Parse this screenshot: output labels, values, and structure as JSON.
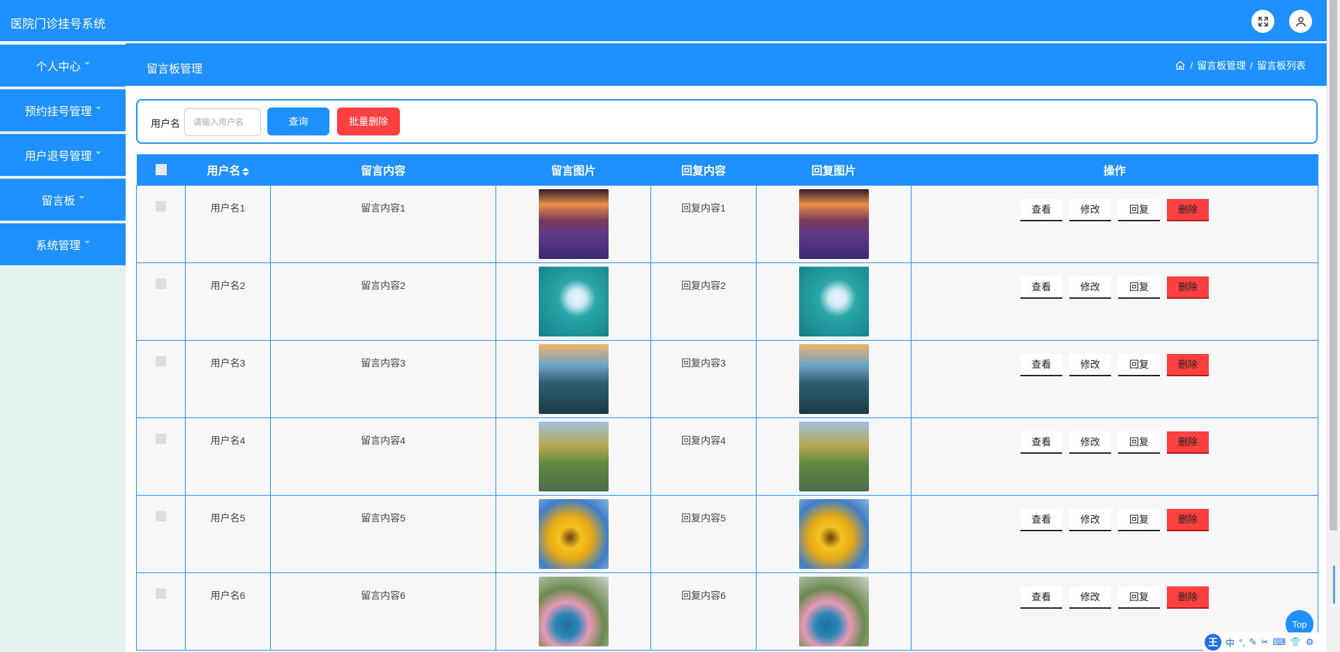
{
  "app": {
    "title": "医院门诊挂号系统"
  },
  "header": {
    "fullscreen_icon": "expand-icon",
    "user_icon": "user-icon"
  },
  "sidebar": {
    "items": [
      {
        "label": "个人中心"
      },
      {
        "label": "预约挂号管理"
      },
      {
        "label": "用户退号管理"
      },
      {
        "label": "留言板"
      },
      {
        "label": "系统管理"
      }
    ]
  },
  "page": {
    "title": "留言板管理",
    "breadcrumb": [
      "留言板管理",
      "留言板列表"
    ],
    "breadcrumb_sep": "/"
  },
  "search": {
    "label": "用户名",
    "placeholder": "请输入用户名",
    "value": "",
    "query_label": "查询",
    "batch_delete_label": "批量删除"
  },
  "table": {
    "columns": [
      "用户名",
      "留言内容",
      "留言图片",
      "回复内容",
      "回复图片",
      "操作"
    ],
    "rows": [
      {
        "username": "用户名1",
        "content": "留言内容1",
        "reply": "回复内容1",
        "image": "lavender-field-image"
      },
      {
        "username": "用户名2",
        "content": "留言内容2",
        "reply": "回复内容2",
        "image": "white-flower-image"
      },
      {
        "username": "用户名3",
        "content": "留言内容3",
        "reply": "回复内容3",
        "image": "lake-town-image"
      },
      {
        "username": "用户名4",
        "content": "留言内容4",
        "reply": "回复内容4",
        "image": "autumn-lake-image"
      },
      {
        "username": "用户名5",
        "content": "留言内容5",
        "reply": "回复内容5",
        "image": "sunflowers-image"
      },
      {
        "username": "用户名6",
        "content": "留言内容6",
        "reply": "回复内容6",
        "image": "flower-pot-image"
      }
    ],
    "actions": {
      "view": "查看",
      "edit": "修改",
      "reply": "回复",
      "delete": "删除"
    }
  },
  "top_button": {
    "label": "Top"
  },
  "ime": {
    "items": [
      "中",
      "°,",
      "✎",
      "✂",
      "⌨",
      "👕",
      "⚙"
    ]
  },
  "colors": {
    "primary": "#1e90ff",
    "danger": "#ff4040",
    "sidebar_bg": "#e4f1ec"
  }
}
